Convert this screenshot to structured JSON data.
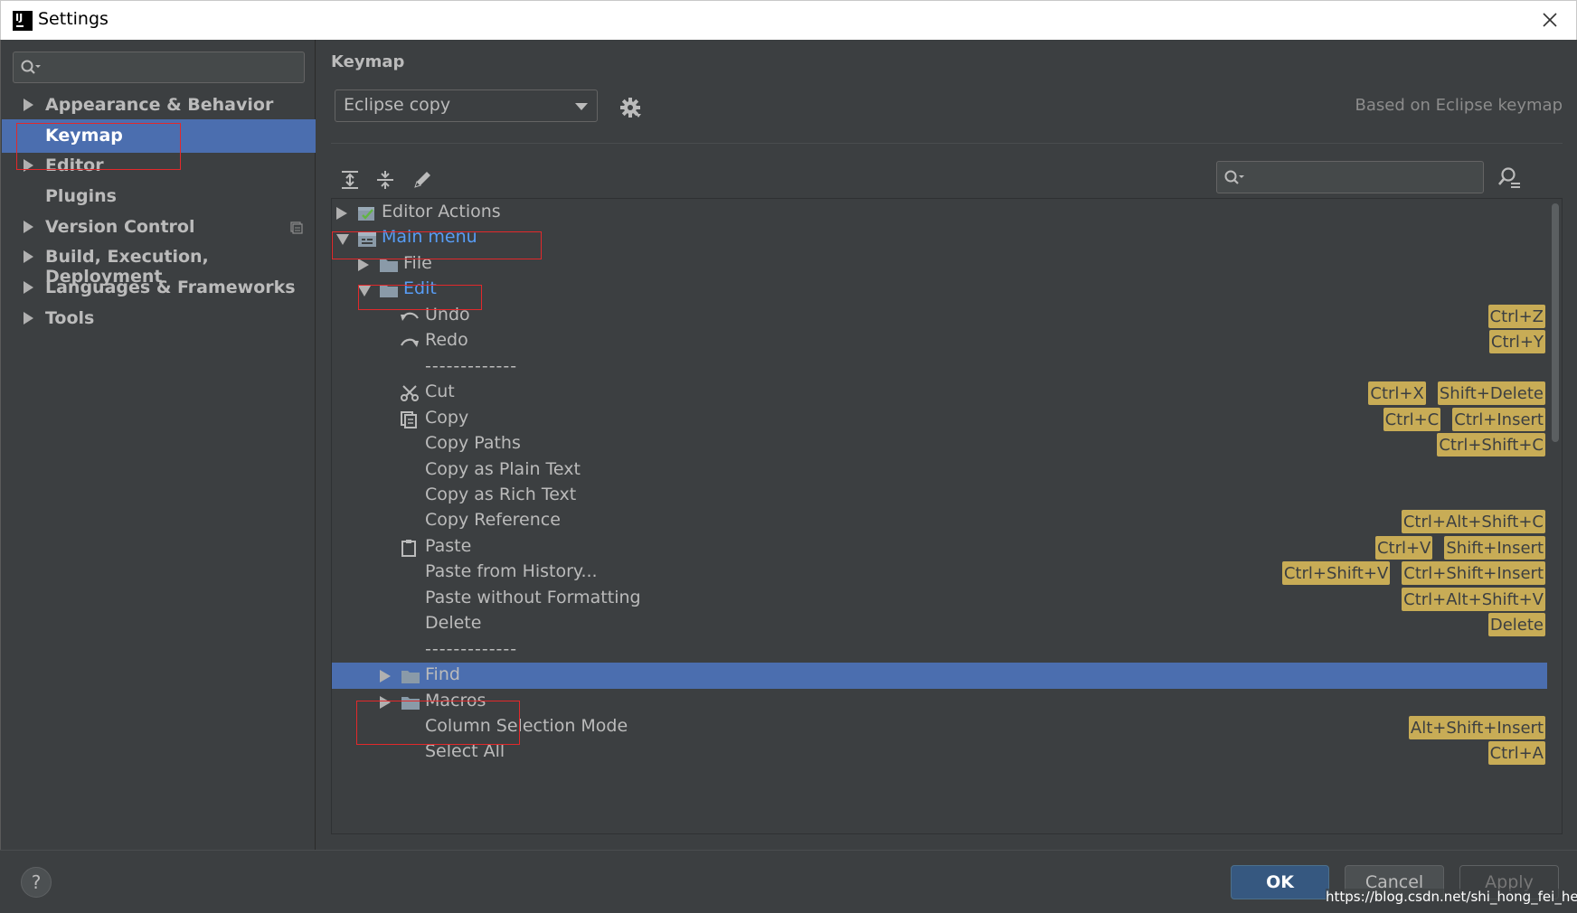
{
  "window": {
    "title": "Settings"
  },
  "sidebar": {
    "search_placeholder": "",
    "items": [
      {
        "label": "Appearance & Behavior",
        "expandable": true
      },
      {
        "label": "Keymap",
        "expandable": false,
        "selected": true
      },
      {
        "label": "Editor",
        "expandable": true
      },
      {
        "label": "Plugins",
        "expandable": false
      },
      {
        "label": "Version Control",
        "expandable": true
      },
      {
        "label": "Build, Execution, Deployment",
        "expandable": true
      },
      {
        "label": "Languages & Frameworks",
        "expandable": true
      },
      {
        "label": "Tools",
        "expandable": true
      }
    ]
  },
  "main": {
    "heading": "Keymap",
    "keymap_select": "Eclipse copy",
    "based_on": "Based on Eclipse keymap",
    "tree_search_placeholder": "",
    "tree": [
      {
        "label": "Editor Actions",
        "icon": "editor-actions-icon",
        "toggle": "closed",
        "shortcuts": []
      },
      {
        "label": "Main menu",
        "icon": "main-menu-icon",
        "toggle": "open",
        "link": true,
        "shortcuts": []
      },
      {
        "label": "File",
        "icon": "folder-icon",
        "toggle": "closed",
        "shortcuts": []
      },
      {
        "label": "Edit",
        "icon": "folder-icon",
        "toggle": "open",
        "link": true,
        "shortcuts": []
      },
      {
        "label": "Undo",
        "icon": "undo-icon",
        "shortcuts": [
          "Ctrl+Z"
        ]
      },
      {
        "label": "Redo",
        "icon": "redo-icon",
        "shortcuts": [
          "Ctrl+Y"
        ]
      },
      {
        "label": "-------------",
        "separator": true,
        "shortcuts": []
      },
      {
        "label": "Cut",
        "icon": "scissors-icon",
        "shortcuts": [
          "Ctrl+X",
          "Shift+Delete"
        ]
      },
      {
        "label": "Copy",
        "icon": "copy-icon",
        "shortcuts": [
          "Ctrl+C",
          "Ctrl+Insert"
        ]
      },
      {
        "label": "Copy Paths",
        "shortcuts": [
          "Ctrl+Shift+C"
        ]
      },
      {
        "label": "Copy as Plain Text",
        "shortcuts": []
      },
      {
        "label": "Copy as Rich Text",
        "shortcuts": []
      },
      {
        "label": "Copy Reference",
        "shortcuts": [
          "Ctrl+Alt+Shift+C"
        ]
      },
      {
        "label": "Paste",
        "icon": "clipboard-icon",
        "shortcuts": [
          "Ctrl+V",
          "Shift+Insert"
        ]
      },
      {
        "label": "Paste from History...",
        "shortcuts": [
          "Ctrl+Shift+V",
          "Ctrl+Shift+Insert"
        ]
      },
      {
        "label": "Paste without Formatting",
        "shortcuts": [
          "Ctrl+Alt+Shift+V"
        ]
      },
      {
        "label": "Delete",
        "shortcuts": [
          "Delete"
        ]
      },
      {
        "label": "-------------",
        "separator": true,
        "shortcuts": []
      },
      {
        "label": "Find",
        "icon": "folder-icon",
        "toggle": "closed",
        "selected": true,
        "shortcuts": []
      },
      {
        "label": "Macros",
        "icon": "folder-icon",
        "toggle": "closed",
        "shortcuts": []
      },
      {
        "label": "Column Selection Mode",
        "shortcuts": [
          "Alt+Shift+Insert"
        ]
      },
      {
        "label": "Select All",
        "shortcuts": [
          "Ctrl+A"
        ]
      }
    ]
  },
  "footer": {
    "help_label": "?",
    "ok_label": "OK",
    "cancel_label": "Cancel",
    "apply_label": "Apply",
    "watermark": "https://blog.csdn.net/shi_hong_fei_hei"
  },
  "colors": {
    "accent": "#4b6eaf",
    "link": "#589df6",
    "shortcut_badge": "#c8ac56",
    "annotation": "#e2292b"
  }
}
